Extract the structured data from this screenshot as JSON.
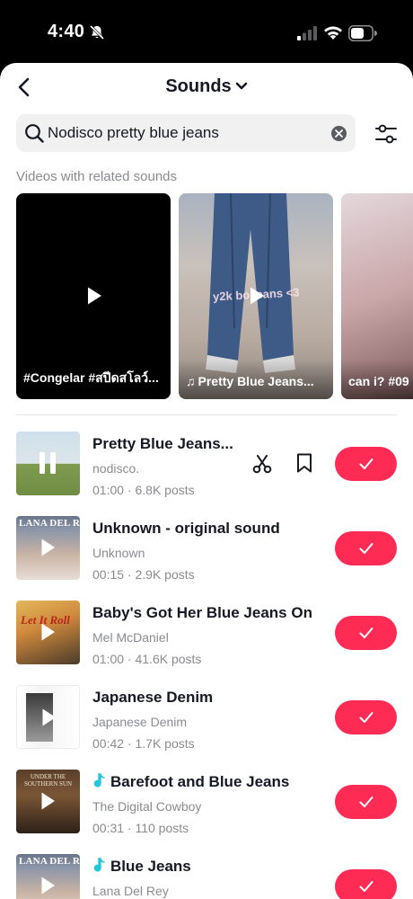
{
  "status_bar": {
    "time": "4:40",
    "icons": [
      "bell-slash-icon",
      "cellular-signal-icon",
      "wifi-icon",
      "battery-icon"
    ]
  },
  "header": {
    "back_icon": "chevron-left-icon",
    "title": "Sounds",
    "title_icon": "chevron-down-icon"
  },
  "search": {
    "value": "Nodisco pretty blue jeans",
    "icon": "search-icon",
    "clear_icon": "clear-x-icon",
    "filter_icon": "sliders-icon"
  },
  "related": {
    "section_label": "Videos with related sounds",
    "videos": [
      {
        "caption": "#Congelar #สปีดสโลว์..."
      },
      {
        "caption": "Pretty Blue Jeans...",
        "overlay_text": "y2k bo jeans <3"
      },
      {
        "caption": "can i? #09"
      }
    ]
  },
  "sounds": [
    {
      "title": "Pretty Blue Jeans...",
      "artist": "nodisco.",
      "meta": "01:00 · 6.8K posts",
      "playing": true,
      "original": false
    },
    {
      "title": "Unknown - original sound",
      "artist": "Unknown",
      "meta": "00:15 · 2.9K posts",
      "playing": false,
      "original": false,
      "cover_text": "LANA DEL REY"
    },
    {
      "title": "Baby's Got Her Blue Jeans On",
      "artist": "Mel McDaniel",
      "meta": "01:00 · 41.6K posts",
      "playing": false,
      "original": false,
      "cover_text": "Let It Roll"
    },
    {
      "title": "Japanese Denim",
      "artist": "Japanese Denim",
      "meta": "00:42 · 1.7K posts",
      "playing": false,
      "original": false
    },
    {
      "title": "Barefoot and Blue Jeans",
      "artist": "The Digital Cowboy",
      "meta": "00:31 · 110 posts",
      "playing": false,
      "original": true,
      "cover_text": "UNDER THE SOUTHERN SUN"
    },
    {
      "title": "Blue Jeans",
      "artist": "Lana Del Rey",
      "meta": "",
      "playing": false,
      "original": true,
      "cover_text": "LANA DEL REY"
    }
  ],
  "colors": {
    "accent": "#fe2c55",
    "text_primary": "#161823",
    "text_secondary": "#8a8b91",
    "search_bg": "#f1f1f2",
    "original_note": "#25c6d9"
  }
}
